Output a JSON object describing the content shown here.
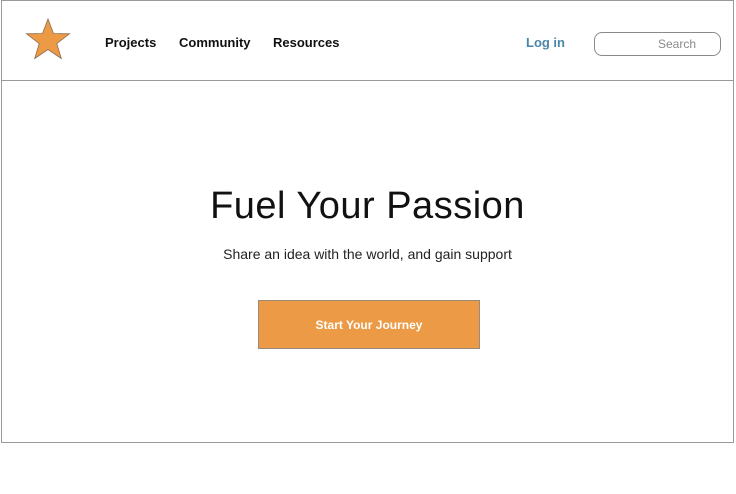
{
  "header": {
    "logo_icon": "star-icon",
    "nav": [
      {
        "label": "Projects"
      },
      {
        "label": "Community"
      },
      {
        "label": "Resources"
      }
    ],
    "login_label": "Log in",
    "search_placeholder": "Search"
  },
  "hero": {
    "title": "Fuel Your Passion",
    "subtitle": "Share an idea with the world, and gain support",
    "cta_label": "Start Your Journey"
  },
  "colors": {
    "accent": "#ec9a45",
    "link": "#4a86a8",
    "border": "#9a9a9a"
  }
}
